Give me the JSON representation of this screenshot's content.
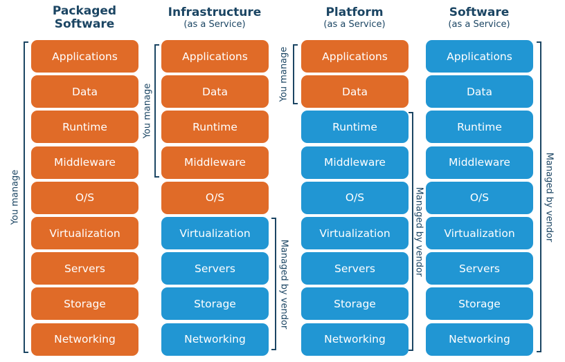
{
  "colors": {
    "you_manage": "#e06b28",
    "vendor": "#2196d3",
    "text": "#1b4563"
  },
  "columns": [
    {
      "title": "Packaged",
      "title2": "Software",
      "subtitle": "",
      "layers": [
        "Applications",
        "Data",
        "Runtime",
        "Middleware",
        "O/S",
        "Virtualization",
        "Servers",
        "Storage",
        "Networking"
      ],
      "you_manage_count": 9
    },
    {
      "title": "Infrastructure",
      "title2": "",
      "subtitle": "(as a Service)",
      "layers": [
        "Applications",
        "Data",
        "Runtime",
        "Middleware",
        "O/S",
        "Virtualization",
        "Servers",
        "Storage",
        "Networking"
      ],
      "you_manage_count": 5
    },
    {
      "title": "Platform",
      "title2": "",
      "subtitle": "(as a Service)",
      "layers": [
        "Applications",
        "Data",
        "Runtime",
        "Middleware",
        "O/S",
        "Virtualization",
        "Servers",
        "Storage",
        "Networking"
      ],
      "you_manage_count": 2
    },
    {
      "title": "Software",
      "title2": "",
      "subtitle": "(as a Service)",
      "layers": [
        "Applications",
        "Data",
        "Runtime",
        "Middleware",
        "O/S",
        "Virtualization",
        "Servers",
        "Storage",
        "Networking"
      ],
      "you_manage_count": 0
    }
  ],
  "labels": {
    "you_manage": "You manage",
    "managed_by_vendor": "Managed by vendor"
  }
}
